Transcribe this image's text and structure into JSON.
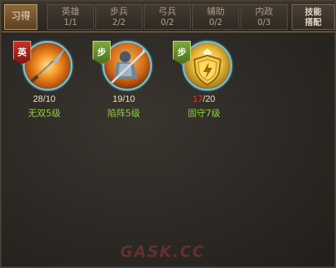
{
  "tabs": [
    {
      "label": "习得",
      "count": "",
      "active": true
    },
    {
      "label": "英雄",
      "count": "1/1"
    },
    {
      "label": "步兵",
      "count": "2/2"
    },
    {
      "label": "弓兵",
      "count": "0/2"
    },
    {
      "label": "辅助",
      "count": "0/2"
    },
    {
      "label": "内政",
      "count": "0/3"
    }
  ],
  "right_button": {
    "line1": "技能",
    "line2": "搭配"
  },
  "skills": [
    {
      "badge": "英",
      "badge_color": "#c5342a",
      "current": "28",
      "max": "10",
      "name": "无双5级",
      "icon": "spear-icon",
      "low": false
    },
    {
      "badge": "步",
      "badge_color": "#7fa83a",
      "current": "19",
      "max": "10",
      "name": "陷阵5级",
      "icon": "warrior-icon",
      "low": false
    },
    {
      "badge": "步",
      "badge_color": "#7fa83a",
      "current": "17",
      "max": "20",
      "name": "固守7级",
      "icon": "shield-icon",
      "low": true
    }
  ],
  "watermark": "GASK.CC"
}
